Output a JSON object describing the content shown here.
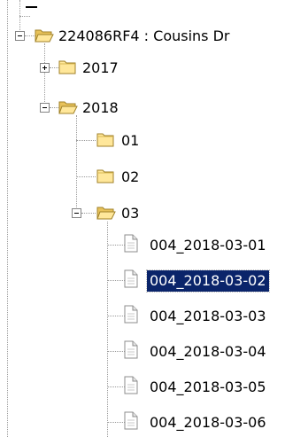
{
  "tree": {
    "root": {
      "label": "224086RF4 : Cousins Dr",
      "expanded": true,
      "icon": "open-folder-icon"
    },
    "years": [
      {
        "label": "2017",
        "expanded": false,
        "icon": "folder-icon"
      },
      {
        "label": "2018",
        "expanded": true,
        "icon": "open-folder-icon"
      }
    ],
    "months": [
      {
        "label": "01",
        "icon": "folder-icon"
      },
      {
        "label": "02",
        "icon": "folder-icon"
      },
      {
        "label": "03",
        "expanded": true,
        "icon": "open-folder-icon"
      }
    ],
    "files": [
      {
        "label": "004_2018-03-01",
        "selected": false,
        "icon": "document-icon"
      },
      {
        "label": "004_2018-03-02",
        "selected": true,
        "icon": "document-icon"
      },
      {
        "label": "004_2018-03-03",
        "selected": false,
        "icon": "document-icon"
      },
      {
        "label": "004_2018-03-04",
        "selected": false,
        "icon": "document-icon"
      },
      {
        "label": "004_2018-03-05",
        "selected": false,
        "icon": "document-icon"
      },
      {
        "label": "004_2018-03-06",
        "selected": false,
        "icon": "document-icon"
      }
    ],
    "colors": {
      "selection_bg": "#0a246a",
      "selection_fg": "#ffffff",
      "folder_fill": "#ffe79a",
      "folder_edge": "#b89b3a",
      "connector": "#9a9a9a"
    }
  }
}
